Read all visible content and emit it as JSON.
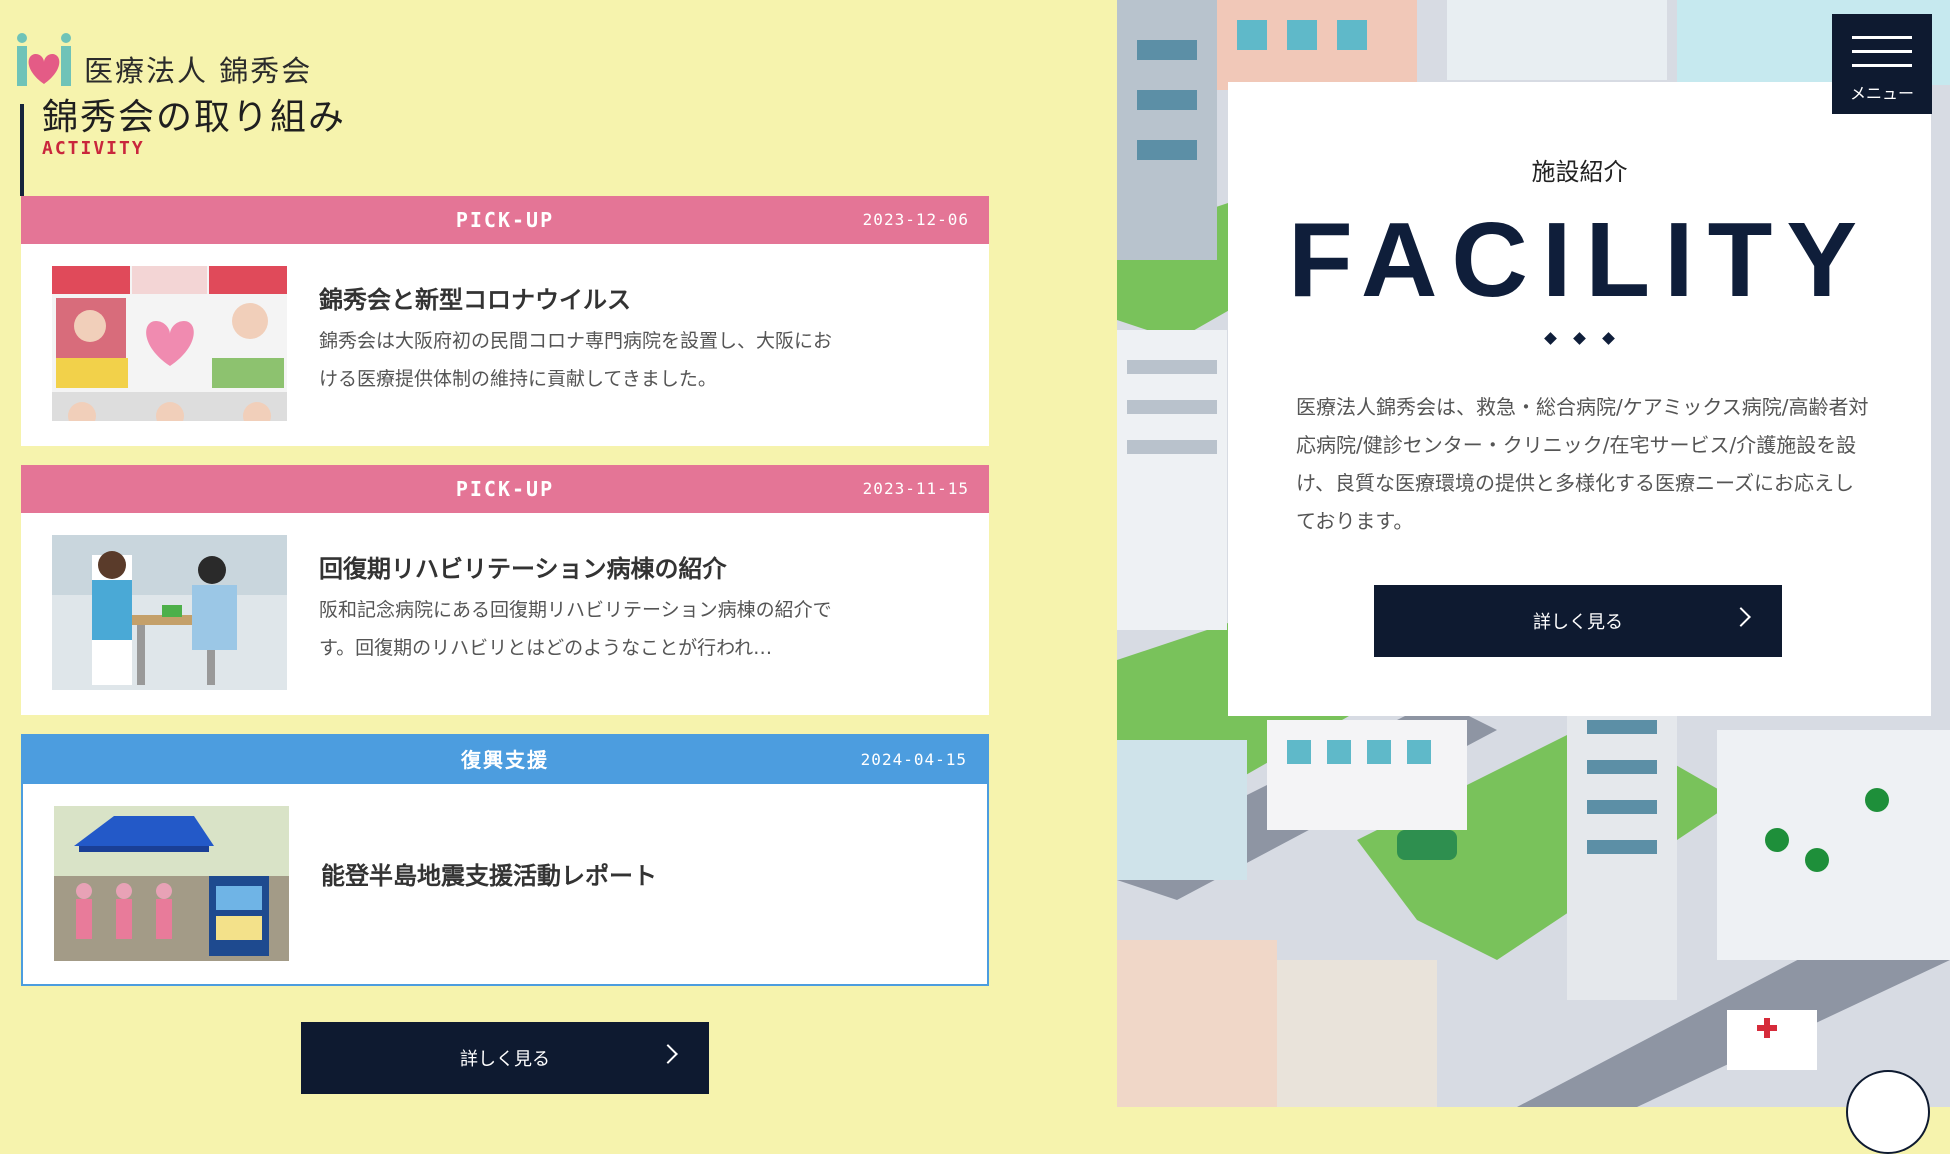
{
  "logo": {
    "org": "医療法人 錦秀会",
    "title": "錦秀会の取り組み",
    "subtitle": "ACTIVITY"
  },
  "cards": [
    {
      "tag": "PICK-UP",
      "date": "2023-12-06",
      "title": "錦秀会と新型コロナウイルス",
      "text": "錦秀会は大阪府初の民間コロナ専門病院を設置し、大阪における医療提供体制の維持に貢献してきました。",
      "color": "#e47596"
    },
    {
      "tag": "PICK-UP",
      "date": "2023-11-15",
      "title": "回復期リハビリテーション病棟の紹介",
      "text": "阪和記念病院にある回復期リハビリテーション病棟の紹介です。回復期のリハビリとはどのようなことが行われ…",
      "color": "#e47596"
    },
    {
      "tag": "復興支援",
      "date": "2024-04-15",
      "title": "能登半島地震支援活動レポート",
      "text": "",
      "color": "#4c9ddf"
    }
  ],
  "activity_button": "詳しく見る",
  "facility": {
    "jp": "施設紹介",
    "en": "FACILITY",
    "text": "医療法人錦秀会は、救急・総合病院/ケアミックス病院/高齢者対応病院/健診センター・クリニック/在宅サービス/介護施設を設け、良質な医療環境の提供と多様化する医療ニーズにお応えしております。",
    "button": "詳しく見る"
  },
  "menu": {
    "label": "メニュー"
  }
}
